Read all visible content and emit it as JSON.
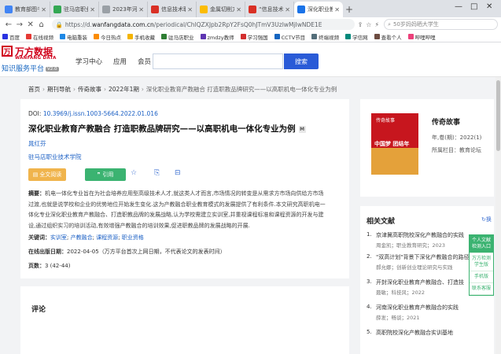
{
  "browser": {
    "tabs": [
      {
        "label": "教育部图书",
        "color": "#4285f4"
      },
      {
        "label": "驻马店职业",
        "color": "#34a853"
      },
      {
        "label": "2023年河",
        "color": "#9aa0a6"
      },
      {
        "label": "信息技术职",
        "color": "#d93025"
      },
      {
        "label": "金属切削刀",
        "color": "#fbbc04"
      },
      {
        "label": "“信息技术",
        "color": "#d93025"
      },
      {
        "label": "深化职业教",
        "color": "#1a73e8",
        "active": true
      }
    ],
    "new_tab": "+",
    "window_controls": [
      "—",
      "□",
      "✕"
    ],
    "url_host": "wanfangdata.com.cn",
    "url_prefix": "https://d.",
    "url_path": "/periodical/ChlQZXJpb2RpY2FsQ0hJTmV3UzlwMjIwNDE1E",
    "search_suggestion": "50岁妈妈晒大学生",
    "nav": {
      "back": "←",
      "forward": "→",
      "reload": "✕",
      "home": "⌂"
    }
  },
  "bookmarks": [
    {
      "label": "百度",
      "color": "#2932e1"
    },
    {
      "label": "在线视频",
      "color": "#e53935"
    },
    {
      "label": "电脑重装",
      "color": "#1e88e5"
    },
    {
      "label": "今日热点",
      "color": "#fb8c00"
    },
    {
      "label": "手机收藏",
      "color": "#f4b400"
    },
    {
      "label": "驻马店职业",
      "color": "#2e7d32"
    },
    {
      "label": "zmdzy教师",
      "color": "#5e35b1"
    },
    {
      "label": "学习强国",
      "color": "#d32f2f"
    },
    {
      "label": "CCTV节目",
      "color": "#1565c0"
    },
    {
      "label": "终端视频",
      "color": "#546e7a"
    },
    {
      "label": "学信网",
      "color": "#00897b"
    },
    {
      "label": "查看个人",
      "color": "#6d4c41"
    },
    {
      "label": "哔哩哔哩",
      "color": "#ec407a"
    }
  ],
  "site": {
    "logo_mark": "万",
    "logo_cn": "万方数据",
    "logo_en": "WANFANG DATA",
    "logo_sub": "知识服务平台",
    "logo_version": "V2.0",
    "nav": [
      "学习中心",
      "应用",
      "会员"
    ],
    "search_placeholder": "",
    "search_button": "搜索"
  },
  "breadcrumb": [
    "首页",
    "期刊导航",
    "传奇故事",
    "2022年1期",
    "深化职业教育产教融合 打造职教品牌研究——以高职机电一体化专业为例"
  ],
  "article": {
    "doi_label": "DOI:",
    "doi": "10.3969/j.issn.1003-5664.2022.01.016",
    "title": "深化职业教育产教融合 打造职教品牌研究——以高职机电一体化专业为例",
    "title_badge": "M",
    "author": "晁红芬",
    "org": "驻马店职业技术学院",
    "btn_read": "全文阅读",
    "btn_cite": "引用",
    "abstract_label": "摘要：",
    "abstract_lines": [
      "机电一体化专业旨在为社会培养应用型高级技术人才,就这类人才而言,市场情况的转变是从需求方市场向供给方市场",
      "过渡,也就是说学校和企业的优势地位开始发生变化.这为产教融合职业教育模式的发展提供了有利条件.本文研究高职机电一",
      "体化专业深化职业教育产教融合、打造职教品牌的发展战略,认为学校需建立实训室,并重视课程标准和课程资源的开发与建",
      "设,通过组织实习的培训活动,有效增强产教融合的培训效果,促进职教品牌的发展战略的开展."
    ],
    "keywords_label": "关键词：",
    "keywords": [
      "实训室",
      "产教融合",
      "课程资源",
      "职业资格"
    ],
    "pubdate_label": "在线出版日期：",
    "pubdate": "2022-04-05",
    "pubdate_note": "（万方平台首次上网日期，不代表论文的发表时间）",
    "pages_label": "页数：",
    "pages": "3 (42-44)"
  },
  "comments": {
    "title": "评论"
  },
  "journal": {
    "name": "传奇故事",
    "year_line": "年,卷(期)：2022(1)",
    "column_line": "所属栏目：教育论坛",
    "cover_head": "传奇故事",
    "cover_text": "中国梦 团结年"
  },
  "related": {
    "title": "相关文献",
    "switch": "换",
    "items": [
      {
        "num": "1.",
        "text": "京津冀高职院校深化产教融合的实践",
        "meta": "周金凯；职业教育研究；2023"
      },
      {
        "num": "2.",
        "text": "\"双高计划\"背景下深化产教融合的路径",
        "meta": "郝允娜；创新创业理论研究与实践"
      },
      {
        "num": "3.",
        "text": "开封深化职业教育产教融合、打造技",
        "meta": "聂敏；科技风；2022"
      },
      {
        "num": "4.",
        "text": "河南深化职业教育产教融合的实践",
        "meta": "薛发；畅谈；2021"
      },
      {
        "num": "5.",
        "text": "高职院校深化产教融合实训基地",
        "meta": ""
      }
    ]
  },
  "float_panel": [
    "个人文献检测入口",
    "万方检测学生版",
    "手机版",
    "联系客服"
  ]
}
